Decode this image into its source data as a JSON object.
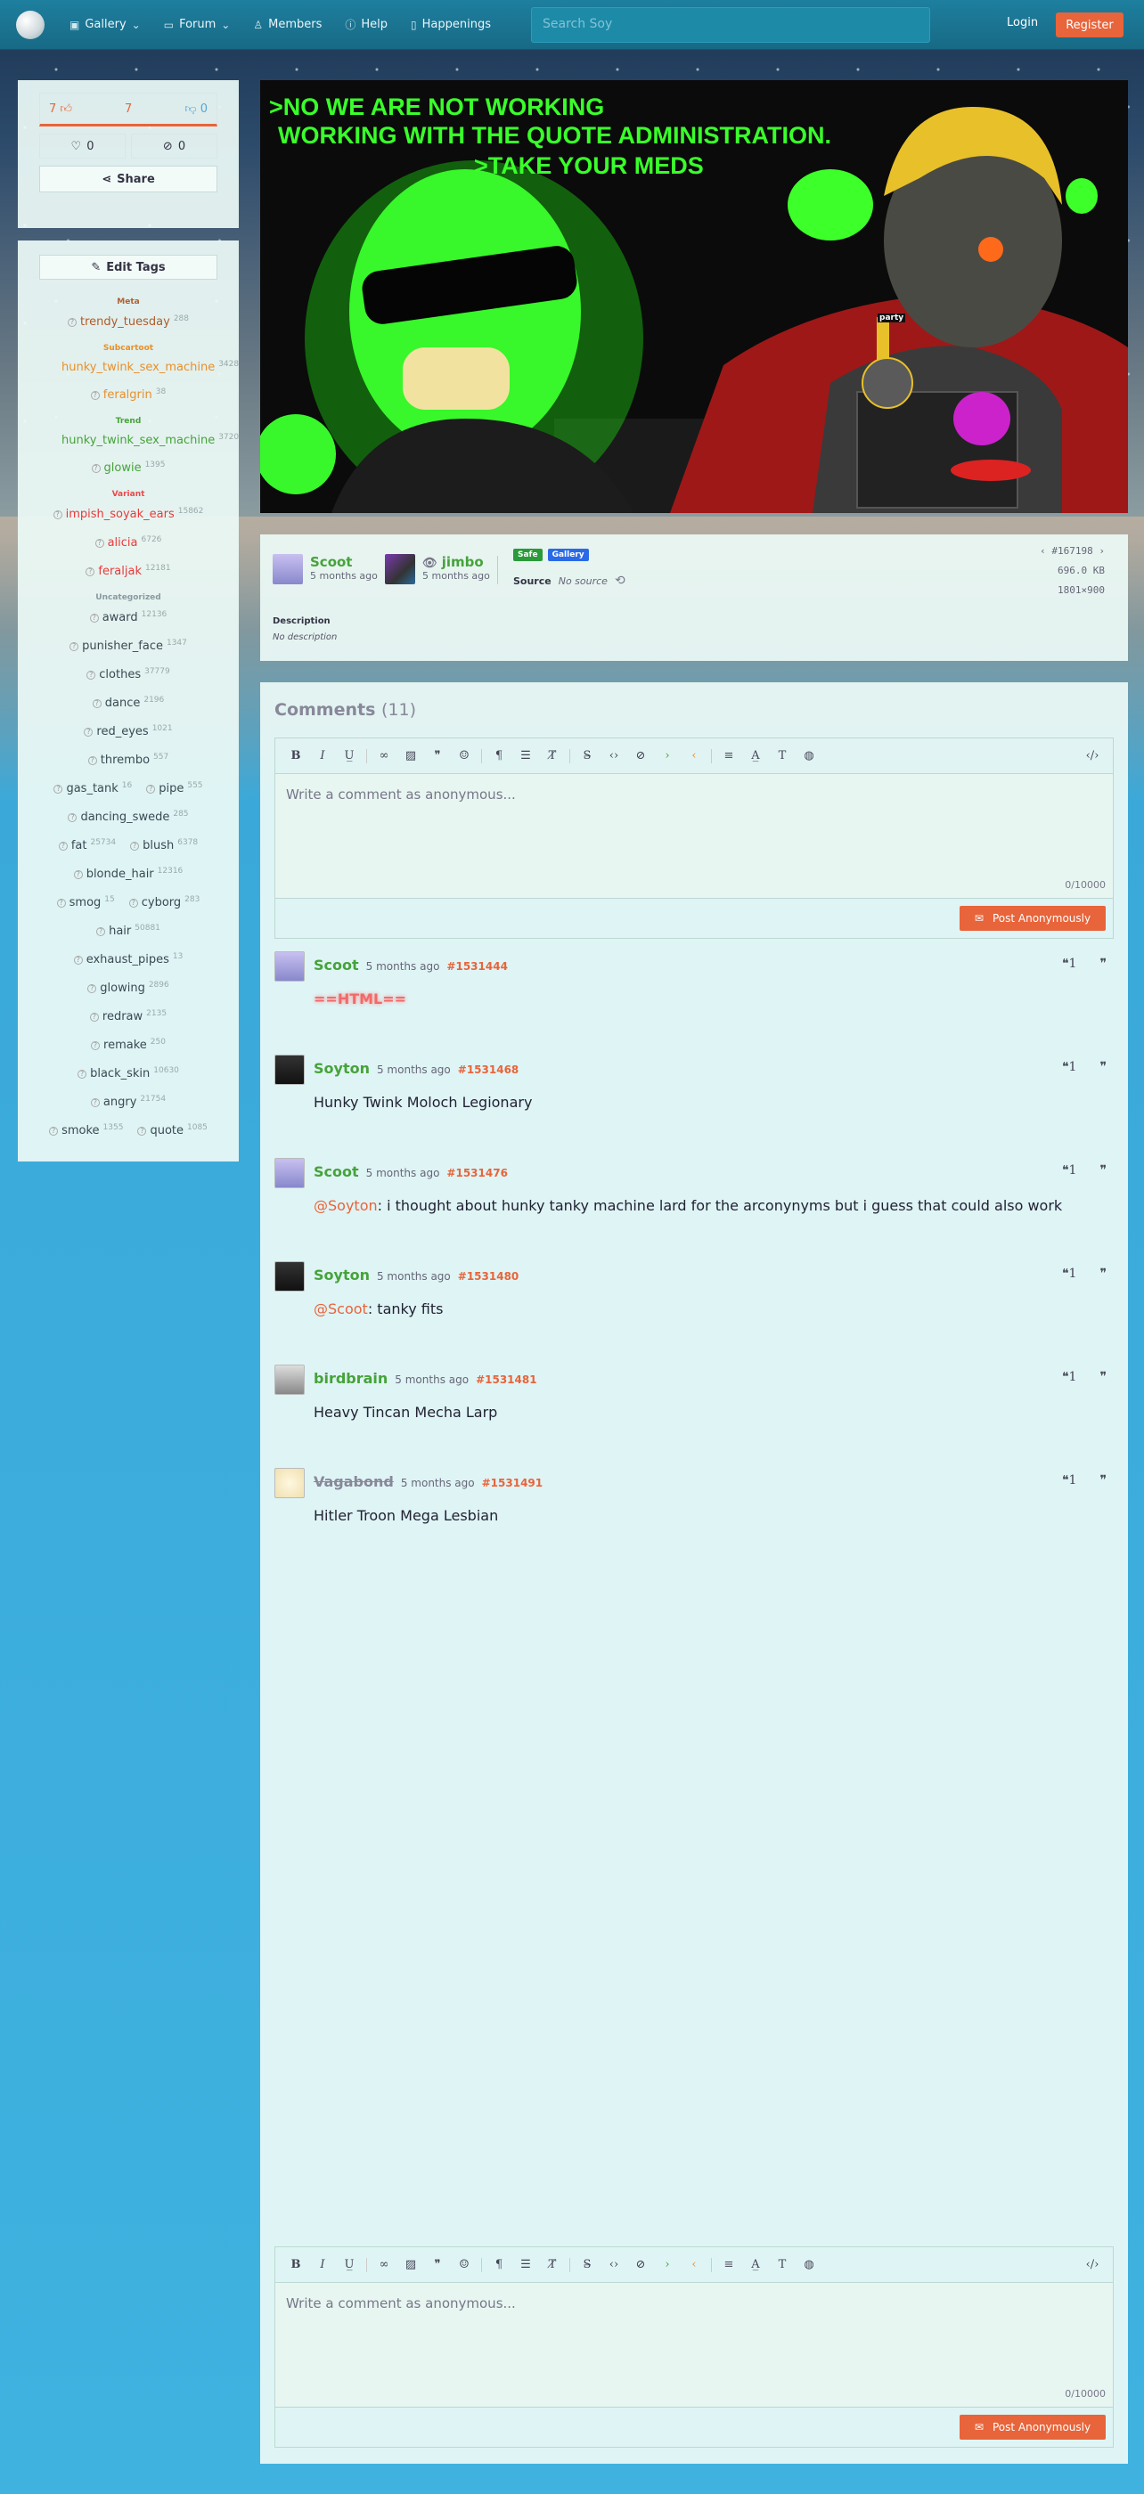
{
  "nav": {
    "items": [
      {
        "icon": "gallery-icon",
        "label": "Gallery",
        "dropdown": true
      },
      {
        "icon": "forum-icon",
        "label": "Forum",
        "dropdown": true
      },
      {
        "icon": "members-icon",
        "label": "Members"
      },
      {
        "icon": "help-icon",
        "label": "Help"
      },
      {
        "icon": "happenings-icon",
        "label": "Happenings"
      }
    ],
    "search_placeholder": "Search Soy",
    "login": "Login",
    "register": "Register"
  },
  "votes": {
    "up": "7",
    "score": "7",
    "down": "0",
    "favorites": "0",
    "hidden": "0",
    "share": "Share"
  },
  "tags": {
    "edit_label": "Edit Tags",
    "categories": [
      {
        "name": "Meta",
        "cls": "meta",
        "rows": [
          [
            {
              "name": "trendy_tuesday",
              "count": "288"
            }
          ]
        ]
      },
      {
        "name": "Subcartoot",
        "cls": "sub",
        "rows": [
          [
            {
              "name": "hunky_twink_sex_machine",
              "count": "3428",
              "wrap": true
            }
          ],
          [
            {
              "name": "feralgrin",
              "count": "38"
            }
          ]
        ]
      },
      {
        "name": "Trend",
        "cls": "trend",
        "rows": [
          [
            {
              "name": "hunky_twink_sex_machine",
              "count": "3720",
              "wrap": true
            }
          ],
          [
            {
              "name": "glowie",
              "count": "1395"
            }
          ]
        ]
      },
      {
        "name": "Variant",
        "cls": "var",
        "rows": [
          [
            {
              "name": "impish_soyak_ears",
              "count": "15862"
            }
          ],
          [
            {
              "name": "alicia",
              "count": "6726"
            }
          ],
          [
            {
              "name": "feraljak",
              "count": "12181"
            }
          ]
        ]
      },
      {
        "name": "Uncategorized",
        "cls": "unc",
        "rows": [
          [
            {
              "name": "award",
              "count": "12136"
            }
          ],
          [
            {
              "name": "punisher_face",
              "count": "1347"
            }
          ],
          [
            {
              "name": "clothes",
              "count": "37779"
            }
          ],
          [
            {
              "name": "dance",
              "count": "2196"
            }
          ],
          [
            {
              "name": "red_eyes",
              "count": "1021"
            }
          ],
          [
            {
              "name": "thrembo",
              "count": "557"
            }
          ],
          [
            {
              "name": "gas_tank",
              "count": "16"
            },
            {
              "name": "pipe",
              "count": "555"
            }
          ],
          [
            {
              "name": "dancing_swede",
              "count": "285"
            }
          ],
          [
            {
              "name": "fat",
              "count": "25734"
            },
            {
              "name": "blush",
              "count": "6378"
            }
          ],
          [
            {
              "name": "blonde_hair",
              "count": "12316"
            }
          ],
          [
            {
              "name": "smog",
              "count": "15"
            },
            {
              "name": "cyborg",
              "count": "283"
            }
          ],
          [
            {
              "name": "hair",
              "count": "50881"
            }
          ],
          [
            {
              "name": "exhaust_pipes",
              "count": "13"
            }
          ],
          [
            {
              "name": "glowing",
              "count": "2896"
            }
          ],
          [
            {
              "name": "redraw",
              "count": "2135"
            }
          ],
          [
            {
              "name": "remake",
              "count": "250"
            }
          ],
          [
            {
              "name": "black_skin",
              "count": "10630"
            }
          ],
          [
            {
              "name": "angry",
              "count": "21754"
            }
          ],
          [
            {
              "name": "smoke",
              "count": "1355"
            },
            {
              "name": "quote",
              "count": "1085"
            }
          ]
        ]
      }
    ]
  },
  "image": {
    "line1": ">NO WE ARE NOT WORKING",
    "line2": "WORKING WITH THE QUOTE ADMINISTRATION.",
    "line3": ">TAKE YOUR MEDS",
    "sign": "party"
  },
  "post": {
    "uploader": "Scoot",
    "uploader_time": "5 months ago",
    "approver": "jimbo",
    "approver_time": "5 months ago",
    "badge_safe": "Safe",
    "badge_gallery": "Gallery",
    "source_label": "Source",
    "source_value": "No source",
    "id": "#167198",
    "size": "696.0 KB",
    "dims": "1801×900",
    "description_label": "Description",
    "description_value": "No description"
  },
  "comments": {
    "title": "Comments",
    "count": "(11)",
    "editor_placeholder": "Write a comment as anonymous...",
    "counter": "0/10000",
    "post_label": "Post Anonymously",
    "items": [
      {
        "user": "Scoot",
        "time": "5 months ago",
        "id": "#1531444",
        "body": "==HTML==",
        "mention": ""
      },
      {
        "user": "Soyton",
        "time": "5 months ago",
        "id": "#1531468",
        "body": "Hunky Twink Moloch Legionary",
        "mention": ""
      },
      {
        "user": "Scoot",
        "time": "5 months ago",
        "id": "#1531476",
        "mention": "@Soyton",
        "body": ": i thought about hunky tanky machine lard for the arconynyms but i guess that could also work"
      },
      {
        "user": "Soyton",
        "time": "5 months ago",
        "id": "#1531480",
        "mention": "@Scoot",
        "body": ": tanky fits"
      },
      {
        "user": "birdbrain",
        "time": "5 months ago",
        "id": "#1531481",
        "body": "Heavy Tincan Mecha Larp",
        "mention": ""
      },
      {
        "user": "Vagabond",
        "time": "5 months ago",
        "id": "#1531491",
        "body": "Hitler Troon Mega Lesbian",
        "mention": ""
      }
    ]
  }
}
